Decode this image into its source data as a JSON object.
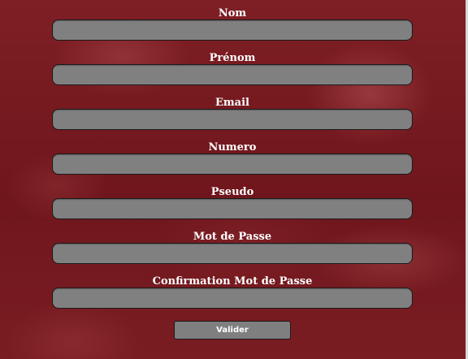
{
  "form": {
    "fields": [
      {
        "label": "Nom",
        "value": ""
      },
      {
        "label": "Prénom",
        "value": ""
      },
      {
        "label": "Email",
        "value": ""
      },
      {
        "label": "Numero",
        "value": ""
      },
      {
        "label": "Pseudo",
        "value": ""
      },
      {
        "label": "Mot de Passe",
        "value": ""
      },
      {
        "label": "Confirmation Mot de Passe",
        "value": ""
      }
    ],
    "submit_label": "Valider"
  },
  "colors": {
    "background": "#7b1c22",
    "input_fill": "#808080",
    "input_border": "#1a1a1a",
    "text": "#ffffff"
  }
}
